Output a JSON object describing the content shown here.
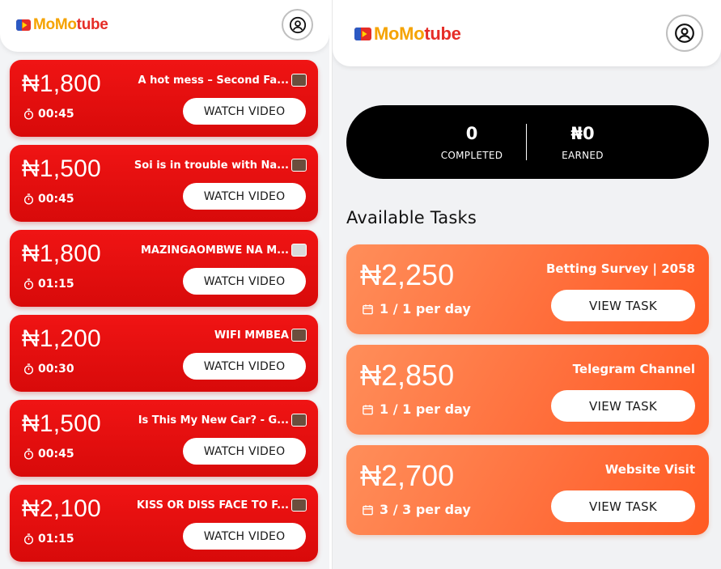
{
  "left": {
    "logo": {
      "part1": "MoMo",
      "part2": "tube"
    },
    "videos": [
      {
        "price": "₦1,800",
        "title": "A hot mess – Second Fa...",
        "duration": "00:45",
        "button": "WATCH VIDEO"
      },
      {
        "price": "₦1,500",
        "title": "Soi is in trouble with Na...",
        "duration": "00:45",
        "button": "WATCH VIDEO"
      },
      {
        "price": "₦1,800",
        "title": "MAZINGAOMBWE NA M...",
        "duration": "01:15",
        "button": "WATCH VIDEO"
      },
      {
        "price": "₦1,200",
        "title": "WIFI MMBEA",
        "duration": "00:30",
        "button": "WATCH VIDEO"
      },
      {
        "price": "₦1,500",
        "title": "Is This My New Car? - G...",
        "duration": "00:45",
        "button": "WATCH VIDEO"
      },
      {
        "price": "₦2,100",
        "title": "KISS OR DISS FACE TO F...",
        "duration": "01:15",
        "button": "WATCH VIDEO"
      }
    ]
  },
  "right": {
    "logo": {
      "part1": "MoMo",
      "part2": "tube"
    },
    "stats": {
      "completed_value": "0",
      "completed_label": "COMPLETED",
      "earned_value": "₦0",
      "earned_label": "EARNED"
    },
    "section_title": "Available Tasks",
    "tasks": [
      {
        "price": "₦2,250",
        "title": "Betting Survey | 2058",
        "limit": "1 / 1 per day",
        "button": "VIEW TASK"
      },
      {
        "price": "₦2,850",
        "title": "Telegram Channel",
        "limit": "1 / 1 per day",
        "button": "VIEW TASK"
      },
      {
        "price": "₦2,700",
        "title": "Website Visit",
        "limit": "3 / 3 per day",
        "button": "VIEW TASK"
      }
    ]
  },
  "colors": {
    "video_card": "#e50f0f",
    "task_card": "#ff6d3a",
    "stats_bar": "#000000",
    "logo_yellow": "#f5a300",
    "logo_red": "#e52d27"
  }
}
